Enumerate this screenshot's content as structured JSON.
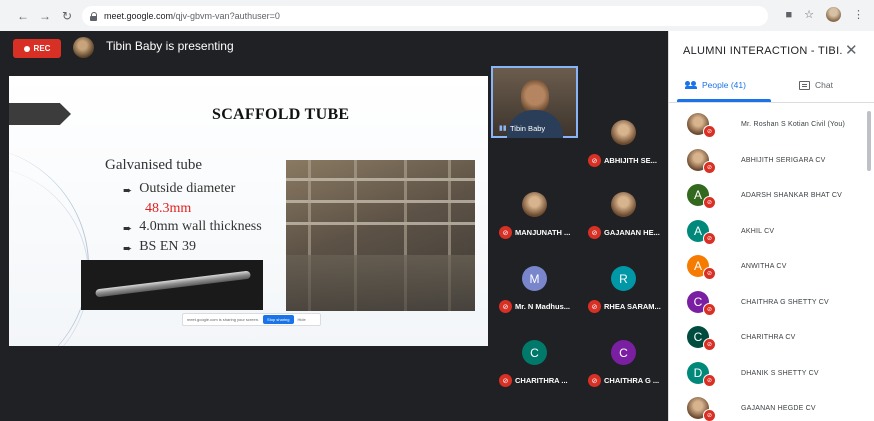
{
  "browser": {
    "url_host": "meet.google.com",
    "url_path": "/qjv-gbvm-van?authuser=0"
  },
  "meet": {
    "rec_label": "REC",
    "presenting_text": "Tibin Baby is presenting"
  },
  "slide": {
    "title": "SCAFFOLD TUBE",
    "subtitle": "Galvanised tube",
    "bullets": [
      "Outside diameter",
      "4.0mm wall thickness",
      "BS EN 39"
    ],
    "diameter_value": "48.3mm",
    "share_text": "meet.google.com is sharing your screen.",
    "share_stop": "Stop sharing",
    "share_hide": "Hide"
  },
  "tiles": [
    {
      "name": "Tibin Baby",
      "type": "video"
    },
    {
      "name": "ABHIJITH SE...",
      "type": "photo"
    },
    {
      "name": "MANJUNATH ...",
      "type": "photo"
    },
    {
      "name": "GAJANAN HE...",
      "type": "photo"
    },
    {
      "name": "Mr. N Madhus...",
      "initial": "M",
      "color": "#7986cb"
    },
    {
      "name": "RHEA SARAM...",
      "initial": "R",
      "color": "#0097a7"
    },
    {
      "name": "CHARITHRA ...",
      "initial": "C",
      "color": "#00796b"
    },
    {
      "name": "CHAITHRA G ...",
      "initial": "C",
      "color": "#7b1fa2"
    }
  ],
  "panel": {
    "title": "ALUMNI INTERACTION - TIBI...",
    "tab_people": "People (41)",
    "tab_chat": "Chat",
    "participants": [
      {
        "name": "Mr. Roshan S Kotian Civil (You)",
        "type": "photo"
      },
      {
        "name": "ABHIJITH SERIGARA CV",
        "type": "photo"
      },
      {
        "name": "ADARSH SHANKAR BHAT CV",
        "initial": "A",
        "color": "#33691e"
      },
      {
        "name": "AKHIL CV",
        "initial": "A",
        "color": "#00897b"
      },
      {
        "name": "ANWITHA CV",
        "initial": "A",
        "color": "#f57c00"
      },
      {
        "name": "CHAITHRA G SHETTY CV",
        "initial": "C",
        "color": "#7b1fa2"
      },
      {
        "name": "CHARITHRA CV",
        "initial": "C",
        "color": "#004d40"
      },
      {
        "name": "DHANIK S SHETTY CV",
        "initial": "D",
        "color": "#00897b"
      },
      {
        "name": "GAJANAN HEGDE CV",
        "type": "photo"
      }
    ]
  },
  "colors": {
    "accent": "#1a73e8",
    "muted_red": "#d93025",
    "stage_bg": "#202124"
  }
}
